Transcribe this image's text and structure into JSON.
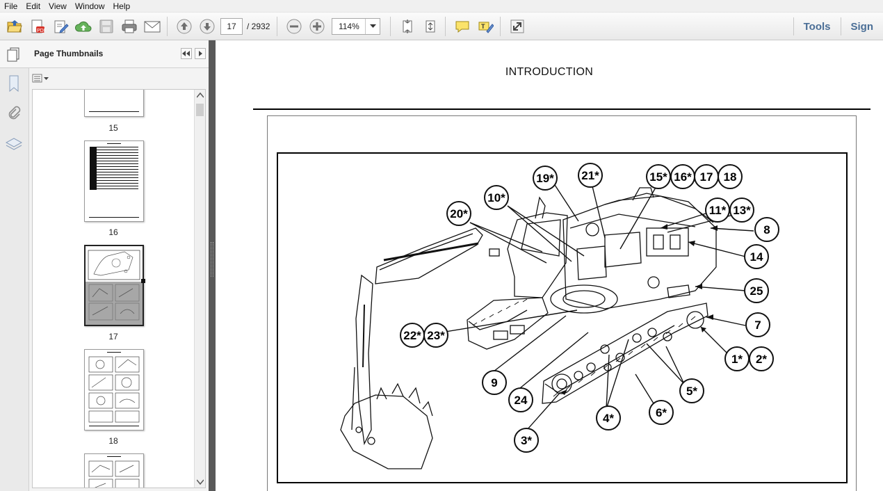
{
  "menu": [
    "File",
    "Edit",
    "View",
    "Window",
    "Help"
  ],
  "toolbar": {
    "current_page": "17",
    "page_total": "/  2932",
    "zoom": "114%",
    "tools_label": "Tools",
    "sign_label": "Sign"
  },
  "thumbnails": {
    "title": "Page Thumbnails",
    "pages": [
      {
        "label": "15"
      },
      {
        "label": "16"
      },
      {
        "label": "17",
        "selected": true
      },
      {
        "label": "18"
      }
    ]
  },
  "document": {
    "heading": "INTRODUCTION",
    "callouts": [
      "19*",
      "21*",
      "15*",
      "16*",
      "17",
      "18",
      "10*",
      "11*",
      "13*",
      "20*",
      "8",
      "14",
      "25",
      "7",
      "1*",
      "2*",
      "22*",
      "23*",
      "9",
      "24",
      "5*",
      "4*",
      "6*",
      "3*"
    ]
  }
}
